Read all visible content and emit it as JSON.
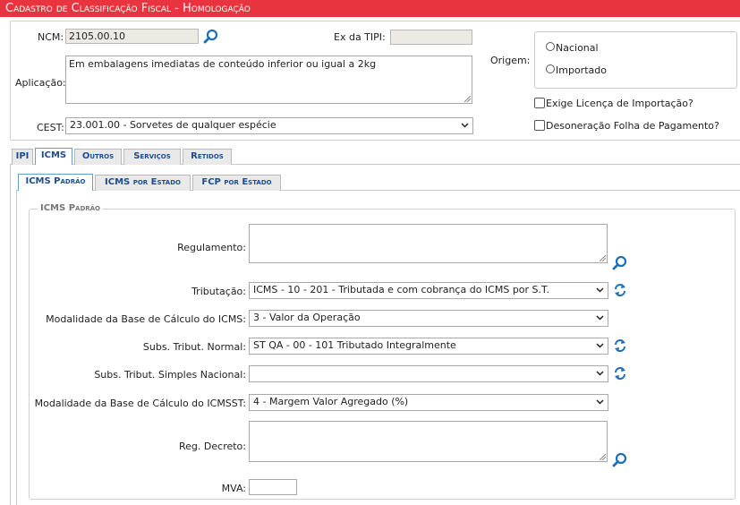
{
  "window": {
    "title": "Cadastro de Classificação Fiscal  - Homologação"
  },
  "header": {
    "ncm_label": "NCM:",
    "ncm_value": "2105.00.10",
    "ex_tipi_label": "Ex da TIPI:",
    "ex_tipi_value": "",
    "aplicacao_label": "Aplicação:",
    "aplicacao_value": "Em embalagens imediatas de conteúdo inferior ou igual a 2kg",
    "cest_label": "CEST:",
    "cest_value": "23.001.00 - Sorvetes de qualquer espécie",
    "origem_label": "Origem:",
    "origem_options": [
      "Nacional",
      "Importado"
    ],
    "exige_licenca_label": "Exige Licença de Importação?",
    "desoneracao_label": "Desoneração Folha de Pagamento?"
  },
  "tabs": [
    "IPI",
    "ICMS",
    "Outros",
    "Serviços",
    "Retidos"
  ],
  "active_tab": "ICMS",
  "subtabs": [
    "ICMS Padrão",
    "ICMS por Estado",
    "FCP por Estado"
  ],
  "active_subtab": "ICMS Padrão",
  "icms_padrao": {
    "legend": "ICMS Padrão",
    "regulamento_label": "Regulamento:",
    "regulamento_value": "",
    "tributacao_label": "Tributação:",
    "tributacao_value": "ICMS - 10 - 201 - Tributada e com cobrança do ICMS por S.T.",
    "modalidade_bc_label": "Modalidade da Base de Cálculo do ICMS:",
    "modalidade_bc_value": "3 - Valor da Operação",
    "subs_normal_label": "Subs. Tribut. Normal:",
    "subs_normal_value": "ST QA - 00 - 101 Tributado Integralmente",
    "subs_simples_label": "Subs. Tribut. Simples Nacional:",
    "subs_simples_value": "",
    "modalidade_bcst_label": "Modalidade da Base de Cálculo do ICMSST:",
    "modalidade_bcst_value": "4 - Margem Valor Agregado (%)",
    "reg_decreto_label": "Reg. Decreto:",
    "reg_decreto_value": "",
    "mva_label": "MVA:",
    "mva_value": ""
  },
  "colors": {
    "title_bar": "#e8343f",
    "tab_text": "#1a4e8c",
    "icon_blue": "#1f6fb5"
  }
}
